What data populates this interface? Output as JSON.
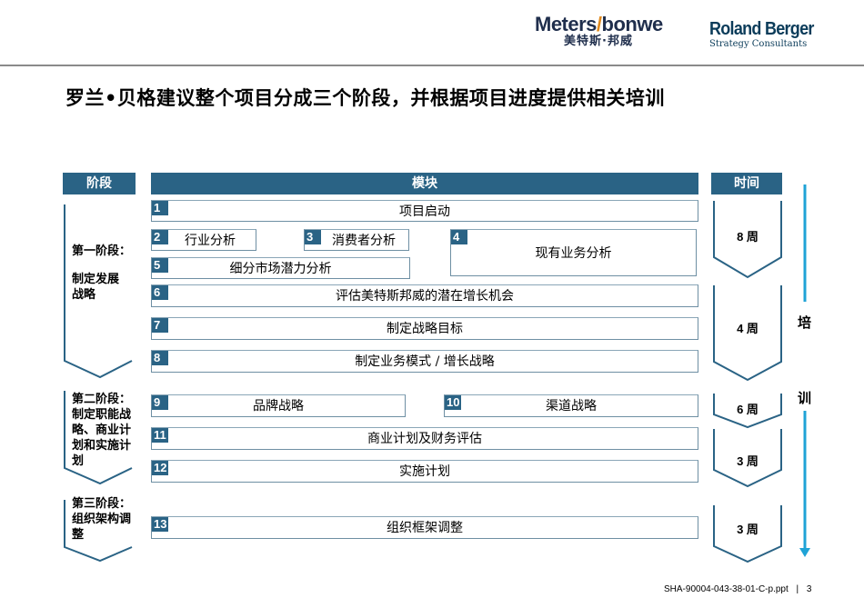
{
  "header": {
    "client_logo": {
      "latin_part1": "Meters",
      "slash": "/",
      "latin_part2": "bonwe",
      "chinese": "美特斯·邦威"
    },
    "consultant_logo": {
      "name": "Roland Berger",
      "subtitle": "Strategy Consultants"
    }
  },
  "title": "罗兰•贝格建议整个项目分成三个阶段，并根据项目进度提供相关培训",
  "columns": {
    "phase": "阶段",
    "module": "模块",
    "time": "时间"
  },
  "phases": [
    {
      "lines": [
        "第一阶段：",
        "",
        "制定发展",
        "战略"
      ]
    },
    {
      "lines": [
        "第二阶段：",
        "制定职能战",
        "略、商业计",
        "划和实施计",
        "划"
      ]
    },
    {
      "lines": [
        "第三阶段：",
        "组织架构调",
        "整"
      ]
    }
  ],
  "modules": [
    {
      "num": "1",
      "label": "项目启动"
    },
    {
      "num": "2",
      "label": "行业分析"
    },
    {
      "num": "3",
      "label": "消费者分析"
    },
    {
      "num": "4",
      "label": "现有业务分析"
    },
    {
      "num": "5",
      "label": "细分市场潜力分析"
    },
    {
      "num": "6",
      "label": "评估美特斯邦威的潜在增长机会"
    },
    {
      "num": "7",
      "label": "制定战略目标"
    },
    {
      "num": "8",
      "label": "制定业务模式 / 增长战略"
    },
    {
      "num": "9",
      "label": "品牌战略"
    },
    {
      "num": "10",
      "label": "渠道战略"
    },
    {
      "num": "11",
      "label": "商业计划及财务评估"
    },
    {
      "num": "12",
      "label": "实施计划"
    },
    {
      "num": "13",
      "label": "组织框架调整"
    }
  ],
  "durations": [
    "8 周",
    "4 周",
    "6 周",
    "3 周",
    "3 周"
  ],
  "training": {
    "char1": "培",
    "char2": "训"
  },
  "colors": {
    "accent": "#2a6385",
    "training_arrow": "#1fa3d6",
    "box_border": "#6e8fa3"
  },
  "footer": {
    "doc_id": "SHA-90004-043-38-01-C-p.ppt",
    "separator": "|",
    "page": "3"
  }
}
